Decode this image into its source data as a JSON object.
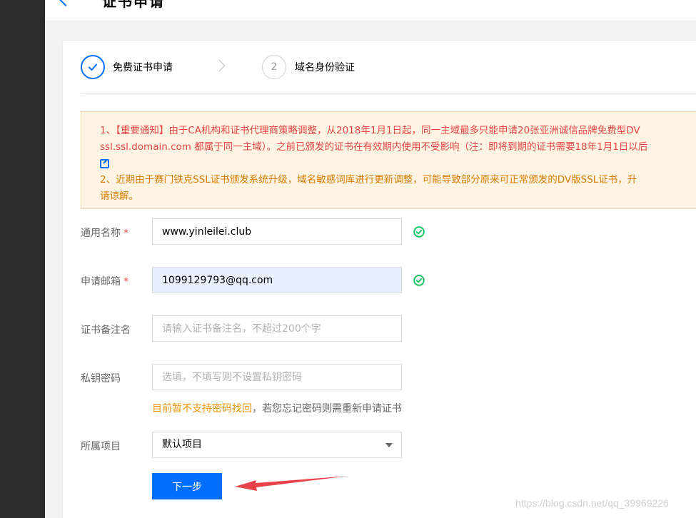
{
  "header": {
    "title": "证书申请"
  },
  "steps": [
    {
      "label": "免费证书申请",
      "state": "done"
    },
    {
      "number": "2",
      "label": "域名身份验证",
      "state": "todo"
    }
  ],
  "notice": {
    "line1": "1、【重要通知】由于CA机构和证书代理商策略调整，从2018年1月1日起，同一主域最多只能申请20张亚洲诚信品牌免费型DV",
    "line2": "ssl.ssl.domain.com 都属于同一主域）。之前已颁发的证书在有效期内使用不受影响（注：即将到期的证书需要18年1月1日以后",
    "line4": "2、近期由于赛门铁克SSL证书颁发系统升级，域名敏感词库进行更新调整，可能导致部分原来可正常颁发的DV版SSL证书，升",
    "line5": "请谅解。"
  },
  "form": {
    "common_name": {
      "label": "通用名称",
      "required_mark": "*",
      "value": "www.yinleilei.club"
    },
    "email": {
      "label": "申请邮箱",
      "required_mark": "*",
      "value": "1099129793@qq.com"
    },
    "remark": {
      "label": "证书备注名",
      "placeholder": "请输入证书备注名，不超过200个字"
    },
    "private_key": {
      "label": "私钥密码",
      "placeholder": "选填，不填写则不设置私钥密码",
      "hint_warning": "目前暂不支持密码找回",
      "hint_rest": "，若您忘记密码则需重新申请证书"
    },
    "project": {
      "label": "所属项目",
      "selected": "默认项目"
    },
    "next_label": "下一步"
  },
  "watermark": "https://blog.csdn.net/qq_39969226",
  "colors": {
    "primary": "#006eff",
    "success": "#0abf5b",
    "error": "#e54545",
    "notice_bg": "#fff4e3",
    "annotation": "#e8434a"
  },
  "icons": [
    "back-arrow-icon",
    "check-icon",
    "chevron-right-icon",
    "external-link-icon",
    "success-check-icon",
    "caret-down-icon"
  ]
}
